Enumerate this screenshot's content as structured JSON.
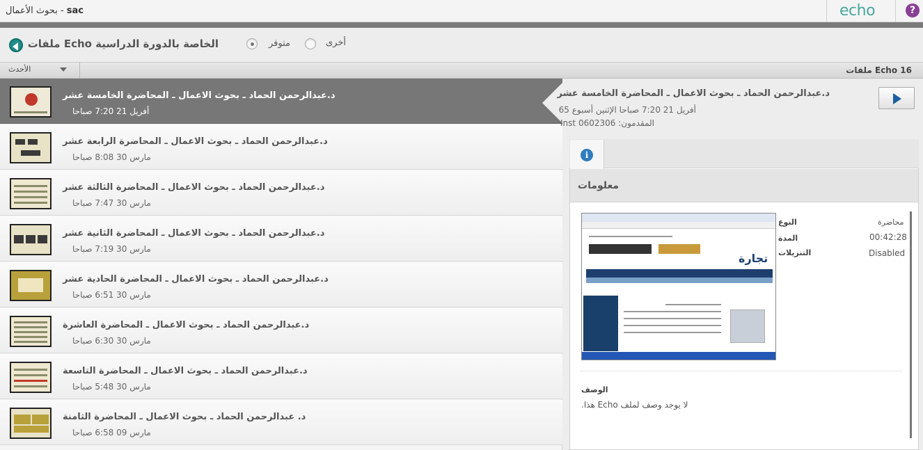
{
  "window": {
    "title_app": "sac",
    "title_course": "- بحوث الأعمال",
    "logo_text": "echo",
    "help_glyph": "?"
  },
  "header": {
    "title": "الخاصة بالدورة الدراسية Echo ملفات",
    "radio_available": "متوفر",
    "radio_other": "أخرى"
  },
  "sortbar": {
    "sort_label": "الأحدث",
    "count_label": "16 Echo ملفات"
  },
  "list": {
    "items": [
      {
        "title": "د.عبدالرحمن الحماد ـ بحوث الاعمال ـ المحاضرة الخامسة عشر",
        "date": "أفريل 21 7:20 صباحا"
      },
      {
        "title": "د.عبدالرحمن الحماد ـ بحوث الاعمال ـ المحاضرة الرابعة عشر",
        "date": "مارس 30 8:08 صباحا"
      },
      {
        "title": "د.عبدالرحمن الحماد ـ بحوث الاعمال ـ المحاضرة الثالثة عشر",
        "date": "مارس 30 7:47 صباحا"
      },
      {
        "title": "د.عبدالرحمن الحماد ـ بحوث الاعمال ـ المحاضرة الثانية عشر",
        "date": "مارس 30 7:19 صباحا"
      },
      {
        "title": "د.عبدالرحمن الحماد ـ بحوث الاعمال ـ المحاضرة الحادية عشر",
        "date": "مارس 30 6:51 صباحا"
      },
      {
        "title": "د.عبدالرحمن الحماد ـ بحوث الاعمال ـ المحاضرة العاشرة",
        "date": "مارس 30 6:30 صباحا"
      },
      {
        "title": "د.عبدالرحمن الحماد ـ بحوث الاعمال ـ المحاضرة التاسعة",
        "date": "مارس 30 5:48 صباحا"
      },
      {
        "title": "د. عبدالرحمن الحماد ـ بحوث الاعمال ـ المحاضرة الثامنة",
        "date": "مارس 09 6:58 صباحا"
      }
    ]
  },
  "detail": {
    "title": "د.عبدالرحمن الحماد ـ بحوث الاعمال ـ المحاضرة الخامسة عشر",
    "date_line": "أفريل 21 7:20 صباحا الإثنين أسبوع 65",
    "presenter_line": "المقدمون: 0602306 Inst",
    "info_glyph": "i",
    "info_heading": "معلومات",
    "preview_logo": "تجارة",
    "fields": {
      "type_label": "النوع",
      "type_value": "محاضرة",
      "duration_label": "المدة",
      "duration_value": "00:42:28",
      "downloads_label": "التنزيلات",
      "downloads_value": "Disabled"
    },
    "description_label": "الوصف",
    "description_text": "لا يوجد وصف لملف Echo هذا."
  }
}
